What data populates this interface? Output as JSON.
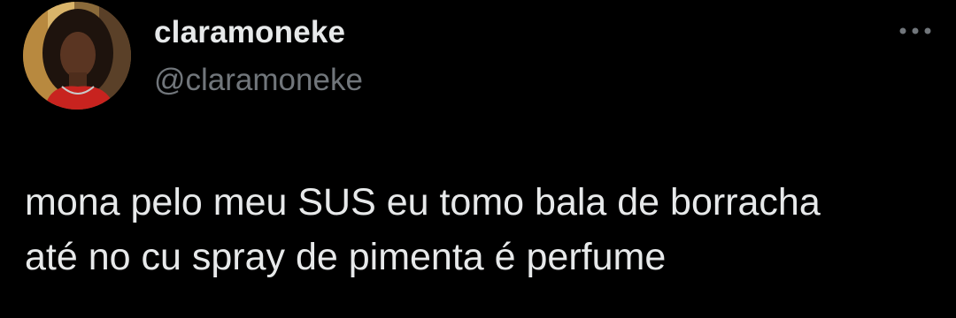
{
  "tweet": {
    "author": {
      "display_name": "claramoneke",
      "handle": "@claramoneke",
      "avatar_icon": "profile-photo"
    },
    "more_icon": "more-horizontal-icon",
    "text": "mona pelo meu SUS eu tomo bala de borracha\naté no cu spray de pimenta é perfume"
  },
  "theme": {
    "background": "#000000",
    "text_primary": "#e7e9ea",
    "text_secondary": "#71767b"
  }
}
